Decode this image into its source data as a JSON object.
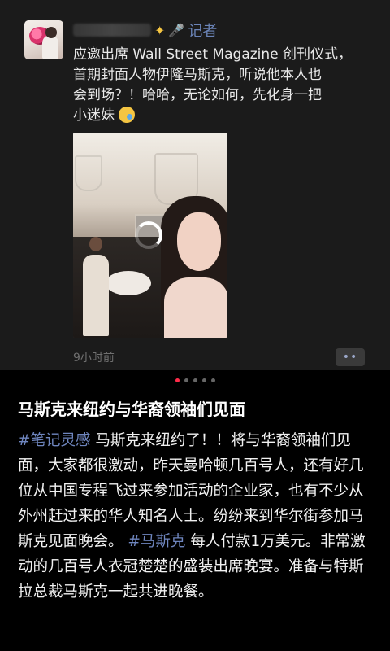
{
  "moment": {
    "author_role": "记者",
    "text_lines": [
      "应邀出席 Wall Street Magazine 创刊仪式，",
      "首期封面人物伊隆马斯克，听说他本人也",
      "会到场？！哈哈，无论如何，先化身一把",
      "小迷妹"
    ],
    "time": "9小时前",
    "more_label": "••",
    "icons": [
      "avatar",
      "sparkle-icon",
      "mic-icon",
      "video-loading-spinner",
      "laugh-emoji-icon",
      "more-icon"
    ]
  },
  "pager": {
    "count": 5,
    "active_index": 0,
    "colors": {
      "active": "#ff2b49",
      "inactive": "#666666"
    }
  },
  "article": {
    "title": "马斯克来纽约与华裔领袖们见面",
    "tag1": "#笔记灵感",
    "text1": "马斯克来纽约了！！将与华裔领袖们见面，大家都很激动，昨天曼哈顿几百号人，还有好几位从中国专程飞过来参加活动的企业家，也有不少从外州赶过来的华人知名人士。纷纷来到华尔街参加马斯克见面晚会。",
    "tag2": "#马斯克",
    "text2": "每人付款1万美元。非常激动的几百号人衣冠楚楚的盛装出席晚宴。准备与特斯拉总裁马斯克一起共进晚餐。",
    "colors": {
      "tag": "#6f86bf",
      "text": "#f1f1f1"
    }
  }
}
